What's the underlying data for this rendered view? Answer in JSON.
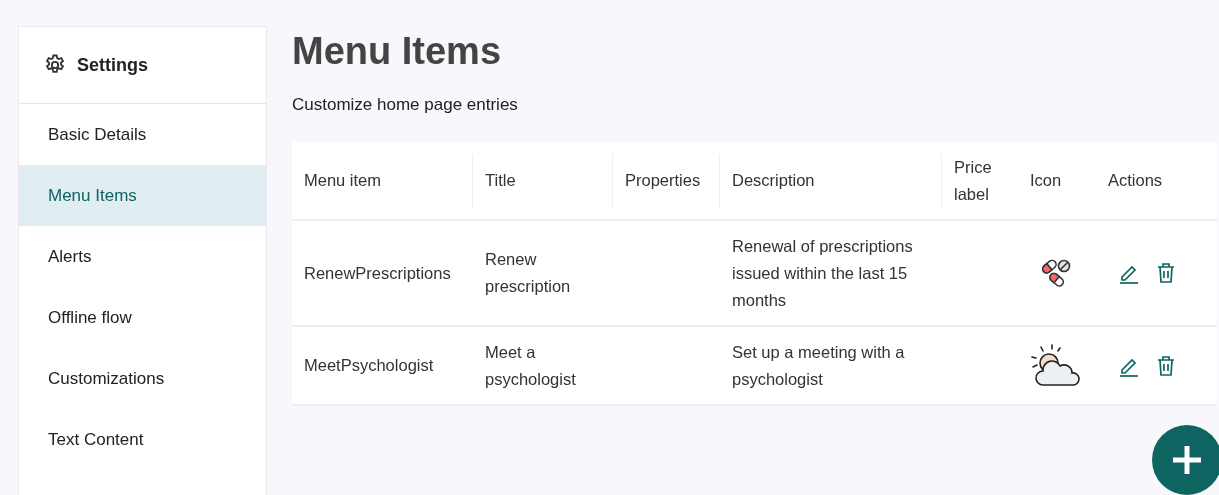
{
  "sidebar": {
    "title": "Settings",
    "items": [
      {
        "label": "Basic Details",
        "selected": false
      },
      {
        "label": "Menu Items",
        "selected": true
      },
      {
        "label": "Alerts",
        "selected": false
      },
      {
        "label": "Offline flow",
        "selected": false
      },
      {
        "label": "Customizations",
        "selected": false
      },
      {
        "label": "Text Content",
        "selected": false
      }
    ]
  },
  "page": {
    "title": "Menu Items",
    "subtitle": "Customize home page entries"
  },
  "table": {
    "columns": [
      "Menu item",
      "Title",
      "Properties",
      "Description",
      "Price label",
      "Icon",
      "Actions"
    ],
    "rows": [
      {
        "menu_item": "RenewPrescriptions",
        "title": "Renew prescription",
        "description": "Renewal of prescriptions issued within the last 15 months",
        "kind": "pills"
      },
      {
        "menu_item": "MeetPsychologist",
        "title": "Meet a psychologist",
        "description": "Set up a meeting with a psychologist",
        "kind": "sun-cloud"
      }
    ]
  }
}
